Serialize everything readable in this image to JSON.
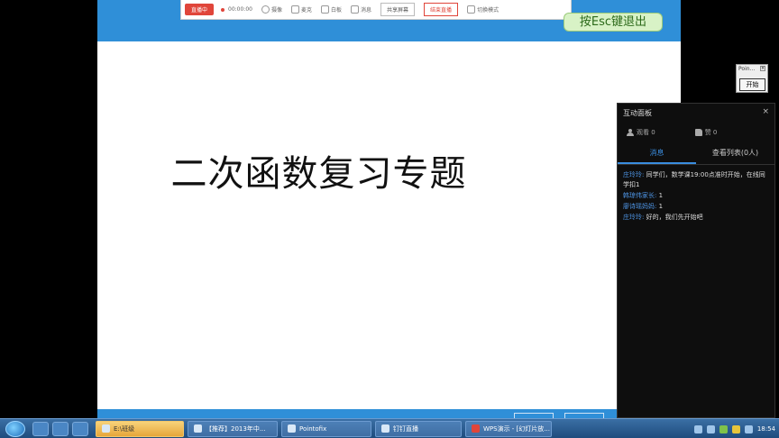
{
  "toolbar": {
    "live_badge": "直播中",
    "timer": "00:00:00",
    "items": [
      {
        "icon": "camera-icon",
        "label": "摄像"
      },
      {
        "icon": "mic-icon",
        "label": "麦克"
      },
      {
        "icon": "whiteboard-icon",
        "label": "白板"
      },
      {
        "icon": "chat-icon",
        "label": "消息"
      }
    ],
    "share_button": "共享屏幕",
    "end_button": "结束直播",
    "switch_label": "切换模式"
  },
  "esc_hint": "按Esc键退出",
  "slide": {
    "title": "二次函数复习专题"
  },
  "pointofix": {
    "title": "Poin...",
    "start_button": "开始"
  },
  "panel": {
    "title": "互动面板",
    "close": "×",
    "viewers": "观看 0",
    "likes": "赞 0",
    "tabs": [
      {
        "label": "消息",
        "active": true
      },
      {
        "label": "查看列表(0人)",
        "active": false
      }
    ],
    "messages": [
      {
        "name": "庄玲玲:",
        "text": "同学们，数学课19:00点准时开始，在线同学扣1"
      },
      {
        "name": "韩琼伟家长:",
        "text": "1"
      },
      {
        "name": "廖诗瑶妈妈:",
        "text": "1"
      },
      {
        "name": "庄玲玲:",
        "text": "好的，我们先开始吧"
      }
    ]
  },
  "taskbar": {
    "tasks": [
      {
        "label": "E:\\班级",
        "active": true,
        "icon": "folder-icon"
      },
      {
        "label": "【推荐】2013年中...",
        "active": false,
        "icon": "browser-icon"
      },
      {
        "label": "Pointofix",
        "active": false,
        "icon": "pen-icon"
      },
      {
        "label": "钉钉直播",
        "active": false,
        "icon": "live-icon"
      },
      {
        "label": "WPS演示 - [幻灯片放...",
        "active": false,
        "icon": "wps-icon"
      }
    ],
    "clock": "18:54"
  }
}
